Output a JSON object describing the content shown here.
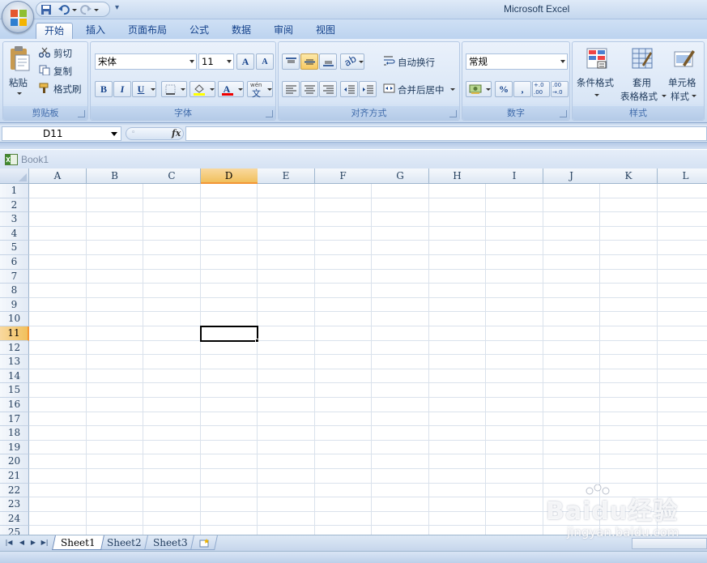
{
  "app": {
    "title": "Microsoft Excel"
  },
  "ribbon_tabs": [
    "开始",
    "插入",
    "页面布局",
    "公式",
    "数据",
    "审阅",
    "视图"
  ],
  "clipboard": {
    "paste": "粘贴",
    "cut": "剪切",
    "copy": "复制",
    "format_painter": "格式刷",
    "label": "剪贴板"
  },
  "font": {
    "name": "宋体",
    "size": "11",
    "grow": "A",
    "shrink": "A",
    "bold": "B",
    "italic": "I",
    "underline": "U",
    "phonetic": "wén",
    "label": "字体"
  },
  "alignment": {
    "wrap_text": "自动换行",
    "merge_center": "合并后居中",
    "label": "对齐方式"
  },
  "number": {
    "format": "常规",
    "percent": "%",
    "comma": ",",
    "increase_decimal": "+.0 .00",
    "decrease_decimal": ".00 →.0",
    "label": "数字"
  },
  "styles": {
    "conditional": "条件格式",
    "table_line1": "套用",
    "table_line2": "表格格式",
    "cell_line1": "单元格",
    "cell_line2": "样式",
    "label": "样式"
  },
  "formula_bar": {
    "name_box": "D11",
    "fx": "fx",
    "value": ""
  },
  "workbook": {
    "name": "Book1"
  },
  "columns": [
    "A",
    "B",
    "C",
    "D",
    "E",
    "F",
    "G",
    "H",
    "I",
    "J",
    "K",
    "L"
  ],
  "rows": [
    "1",
    "2",
    "3",
    "4",
    "5",
    "6",
    "7",
    "8",
    "9",
    "10",
    "11",
    "12",
    "13",
    "14",
    "15",
    "16",
    "17",
    "18",
    "19",
    "20",
    "21",
    "22",
    "23",
    "24",
    "25"
  ],
  "selection": {
    "column": "D",
    "row": "11"
  },
  "sheets": [
    "Sheet1",
    "Sheet2",
    "Sheet3"
  ],
  "active_sheet": "Sheet1",
  "watermark": {
    "main": "Baidu经验",
    "sub": "jingyan.baidu.com"
  },
  "colors": {
    "accent": "#15428b",
    "selected_header": "#f1c05c",
    "ribbon_bg": "#d9e6f6"
  }
}
